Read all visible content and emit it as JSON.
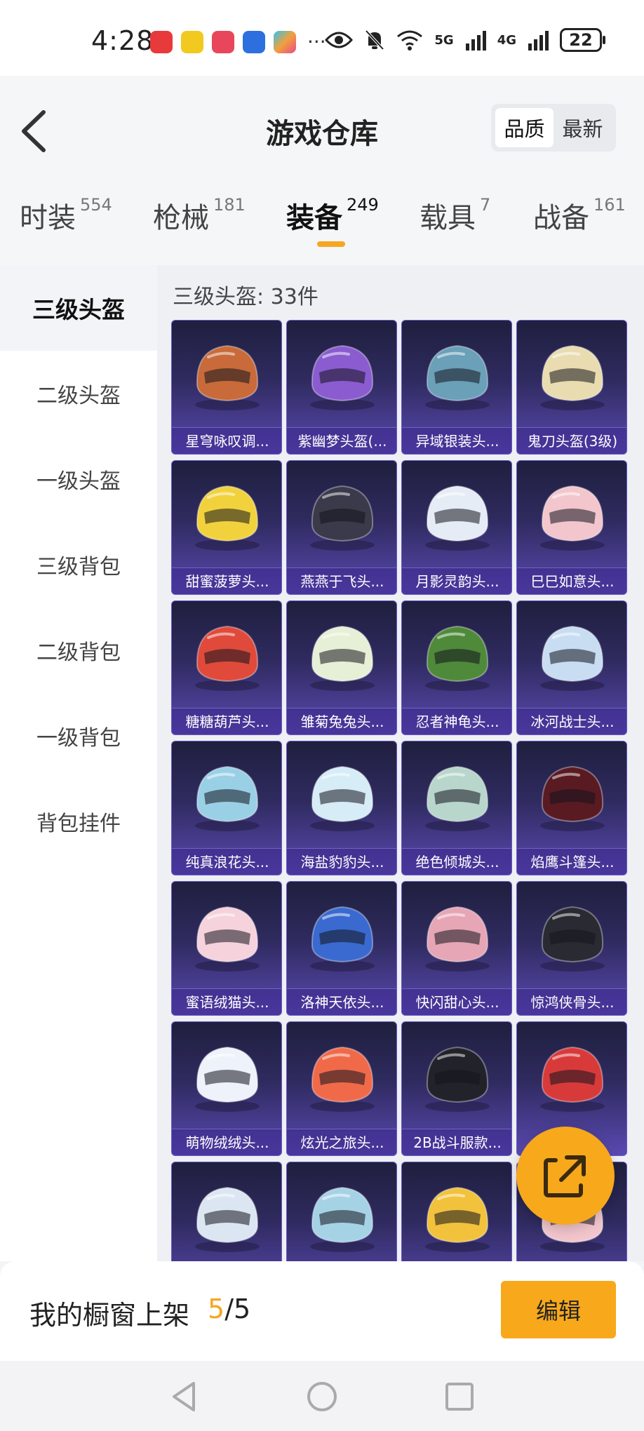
{
  "status_bar": {
    "time": "4:28",
    "network_1": "5G",
    "network_2": "4G",
    "battery": "22"
  },
  "header": {
    "title": "游戏仓库",
    "sort_options": [
      {
        "label": "品质",
        "active": true
      },
      {
        "label": "最新",
        "active": false
      }
    ]
  },
  "tabs": [
    {
      "label": "时装",
      "count": "554",
      "active": false
    },
    {
      "label": "枪械",
      "count": "181",
      "active": false
    },
    {
      "label": "装备",
      "count": "249",
      "active": true
    },
    {
      "label": "载具",
      "count": "7",
      "active": false
    },
    {
      "label": "战备",
      "count": "161",
      "active": false
    }
  ],
  "sidebar": {
    "items": [
      {
        "label": "三级头盔",
        "active": true
      },
      {
        "label": "二级头盔",
        "active": false
      },
      {
        "label": "一级头盔",
        "active": false
      },
      {
        "label": "三级背包",
        "active": false
      },
      {
        "label": "二级背包",
        "active": false
      },
      {
        "label": "一级背包",
        "active": false
      },
      {
        "label": "背包挂件",
        "active": false
      }
    ]
  },
  "content": {
    "section_title": "三级头盔: 33件",
    "items": [
      {
        "name": "星穹咏叹调...",
        "color": "#c86a3a"
      },
      {
        "name": "紫幽梦头盔(...",
        "color": "#8a5cd0"
      },
      {
        "name": "异域银装头...",
        "color": "#6aa0b8"
      },
      {
        "name": "鬼刀头盔(3级)",
        "color": "#e8dcb0"
      },
      {
        "name": "甜蜜菠萝头...",
        "color": "#f2d23c"
      },
      {
        "name": "燕燕于飞头...",
        "color": "#3a3a4a"
      },
      {
        "name": "月影灵韵头...",
        "color": "#e6ecf6"
      },
      {
        "name": "巳巳如意头...",
        "color": "#f2c6cc"
      },
      {
        "name": "糖糖葫芦头...",
        "color": "#e04a3a"
      },
      {
        "name": "雏菊兔兔头...",
        "color": "#e6f0d6"
      },
      {
        "name": "忍者神龟头...",
        "color": "#4e8a3a"
      },
      {
        "name": "冰河战士头...",
        "color": "#c8dcf2"
      },
      {
        "name": "纯真浪花头...",
        "color": "#9ad0e6"
      },
      {
        "name": "海盐豹豹头...",
        "color": "#d6ecf6"
      },
      {
        "name": "绝色倾城头...",
        "color": "#b8d6cc"
      },
      {
        "name": "焰鹰斗篷头...",
        "color": "#5a1a22"
      },
      {
        "name": "蜜语绒猫头...",
        "color": "#f6d2dc"
      },
      {
        "name": "洛神天依头...",
        "color": "#3a6ad0"
      },
      {
        "name": "快闪甜心头...",
        "color": "#e6a6b6"
      },
      {
        "name": "惊鸿侠骨头...",
        "color": "#2a2a32"
      },
      {
        "name": "萌物绒绒头...",
        "color": "#eef2fa"
      },
      {
        "name": "炫光之旅头...",
        "color": "#f06a4a"
      },
      {
        "name": "2B战斗服款...",
        "color": "#22232a"
      },
      {
        "name": "",
        "color": "#d83a3a"
      },
      {
        "name": "",
        "color": "#dce6f2"
      },
      {
        "name": "",
        "color": "#a6d2e6"
      },
      {
        "name": "",
        "color": "#f2c23c"
      },
      {
        "name": "",
        "color": "#f2c6cc"
      }
    ]
  },
  "showcase": {
    "label": "我的橱窗上架",
    "current": "5",
    "total": "/5",
    "edit_label": "编辑"
  },
  "colors": {
    "accent": "#f5a623",
    "card_gradient_top": "#1f1f3e",
    "card_gradient_bottom": "#5a49b2"
  }
}
